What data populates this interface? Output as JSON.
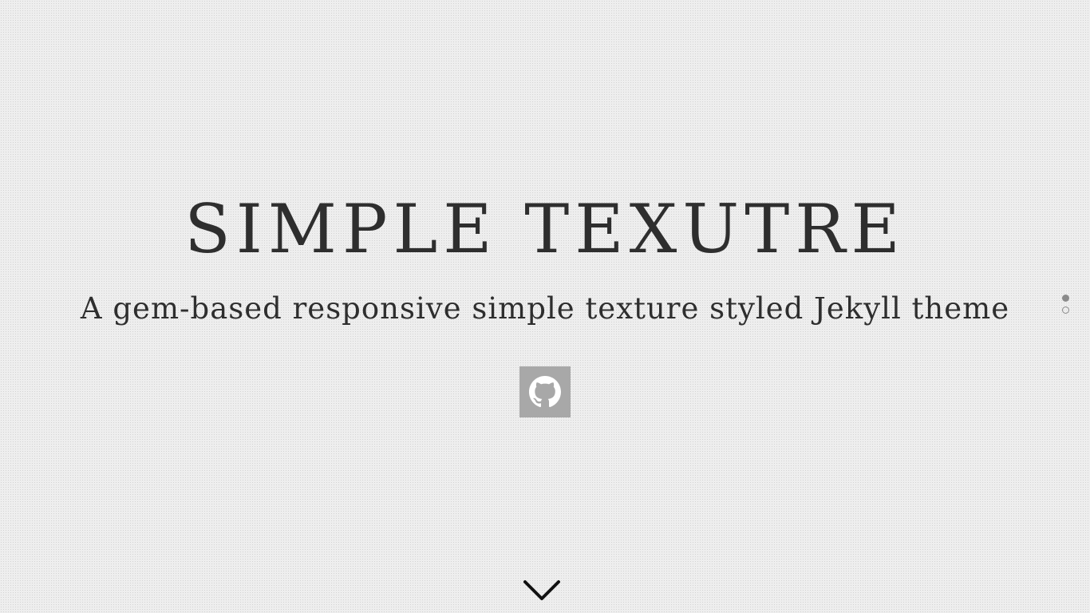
{
  "hero": {
    "title": "SIMPLE TEXUTRE",
    "subtitle": "A gem-based responsive simple texture styled Jekyll theme"
  },
  "social": {
    "icon": "github-icon",
    "background_color": "#a8a8a8"
  },
  "page_indicator": {
    "dots": [
      "active",
      "inactive"
    ]
  },
  "scroll": {
    "icon": "chevron-down-icon"
  },
  "colors": {
    "background": "#eeeeee",
    "text": "#2e2e2e"
  }
}
